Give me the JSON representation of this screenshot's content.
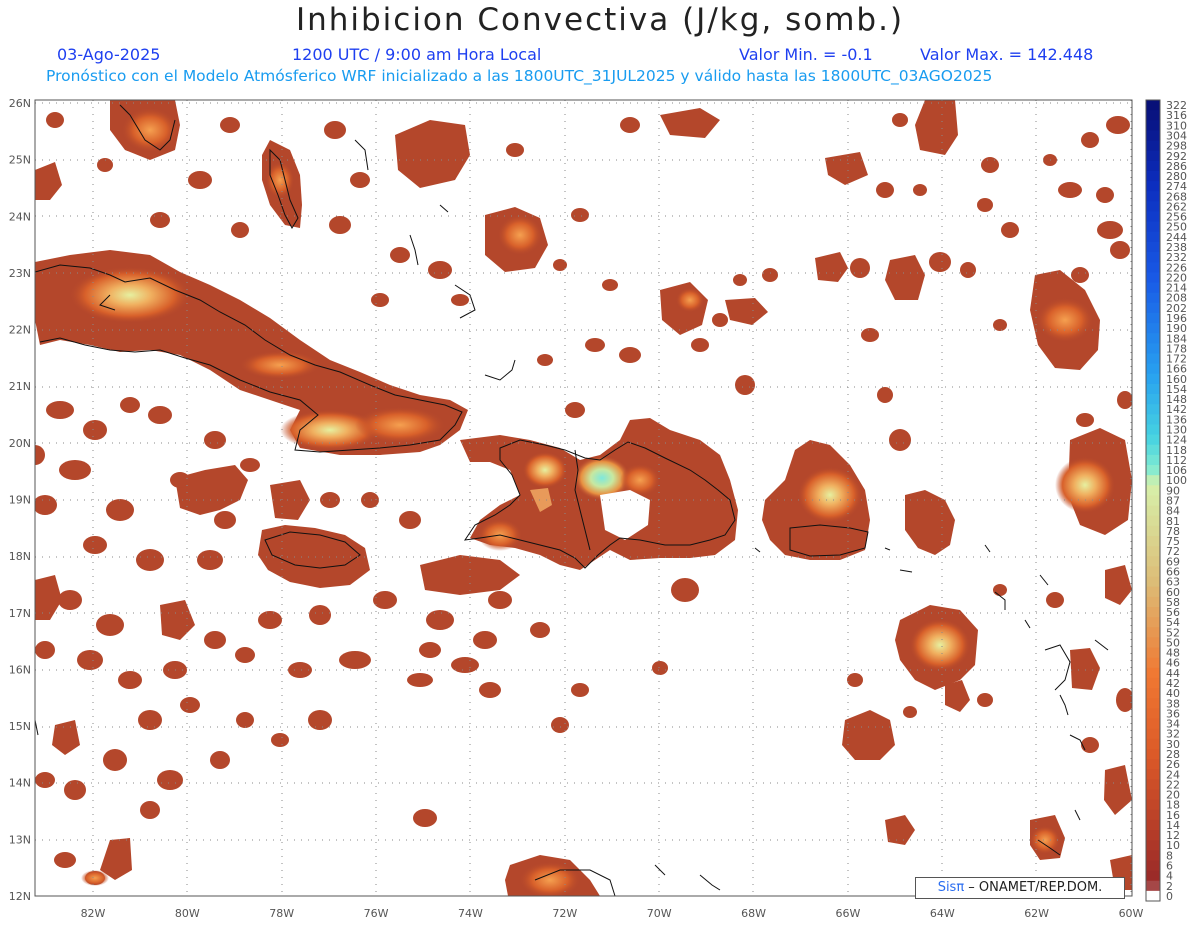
{
  "title": "Inhibicion Convectiva (J/kg, somb.)",
  "header": {
    "date": "03-Ago-2025",
    "time": "1200 UTC / 9:00 am Hora Local",
    "valmin": "Valor Min. = -0.1",
    "valmax": "Valor Max. = 142.448",
    "forecast": "Pronóstico con el Modelo Atmósferico WRF inicializado a las 1800UTC_31JUL2025 y válido hasta las  1800UTC_03AGO2025"
  },
  "map": {
    "lon_range": [
      -83.2,
      -60.0
    ],
    "lat_range": [
      12.0,
      26.2
    ],
    "lat_labels": [
      "26N",
      "25N",
      "24N",
      "23N",
      "22N",
      "21N",
      "20N",
      "19N",
      "18N",
      "17N",
      "16N",
      "15N",
      "14N",
      "13N",
      "12N"
    ],
    "lon_labels": [
      "82W",
      "80W",
      "78W",
      "76W",
      "74W",
      "72W",
      "70W",
      "68W",
      "66W",
      "64W",
      "62W",
      "60W"
    ]
  },
  "colorbar": {
    "labels": [
      "322",
      "316",
      "310",
      "304",
      "298",
      "292",
      "286",
      "280",
      "274",
      "268",
      "262",
      "256",
      "250",
      "244",
      "238",
      "232",
      "226",
      "220",
      "214",
      "208",
      "202",
      "196",
      "190",
      "184",
      "178",
      "172",
      "166",
      "160",
      "154",
      "148",
      "142",
      "136",
      "130",
      "124",
      "118",
      "112",
      "106",
      "100",
      "90",
      "87",
      "84",
      "81",
      "78",
      "75",
      "72",
      "69",
      "66",
      "63",
      "60",
      "58",
      "56",
      "54",
      "52",
      "50",
      "48",
      "46",
      "44",
      "42",
      "40",
      "38",
      "36",
      "34",
      "32",
      "30",
      "28",
      "26",
      "24",
      "22",
      "20",
      "18",
      "16",
      "14",
      "12",
      "10",
      "8",
      "6",
      "4",
      "2",
      "0"
    ]
  },
  "credit": {
    "brand": "Sisπ",
    "text": " – ONAMET/REP.DOM."
  }
}
